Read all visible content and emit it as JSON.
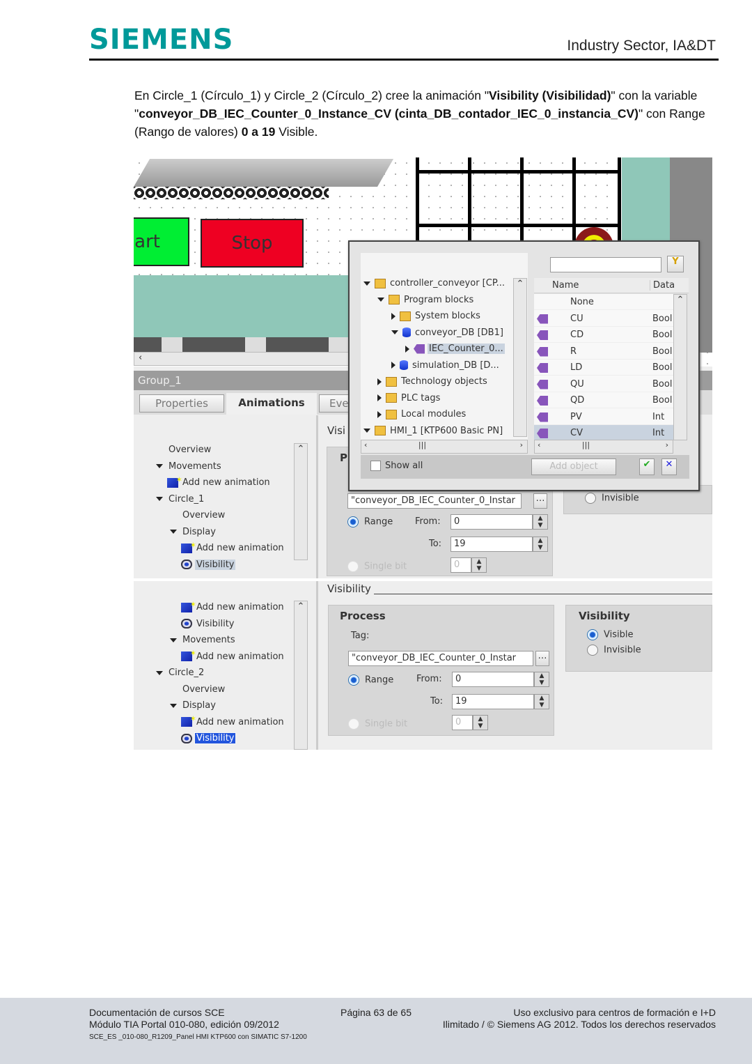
{
  "header": {
    "logo": "SIEMENS",
    "sector": "Industry Sector, IA&DT"
  },
  "intro": {
    "p1": "En Circle_1 (Círculo_1) y Circle_2 (Círculo_2) cree la animación \"",
    "b1": "Visibility (Visibilidad)",
    "p2": "\" con la variable \"",
    "b2": "conveyor_DB_IEC_Counter_0_Instance_CV (cinta_DB_contador_IEC_0_instancia_CV)",
    "p3": "\" con Range (Rango de valores) ",
    "b3": "0 a 19",
    "p4": " Visible."
  },
  "hmi": {
    "start_label": "art",
    "stop_label": "Stop",
    "colors": {
      "start": "#00ee33",
      "stop": "#ee0022",
      "teal": "#8fc7b8"
    }
  },
  "inspector": {
    "object": "Group_1",
    "tabs": [
      "Properties",
      "Animations",
      "Eve"
    ],
    "section_cut": "Visi",
    "process_cut": "P"
  },
  "tree_top": [
    {
      "label": "Overview",
      "lvl": 1,
      "icon": "",
      "exp": ""
    },
    {
      "label": "Movements",
      "lvl": 1,
      "icon": "",
      "exp": "d"
    },
    {
      "label": "Add new animation",
      "lvl": 1,
      "icon": "add",
      "exp": ""
    },
    {
      "label": "Circle_1",
      "lvl": 1,
      "icon": "",
      "exp": "d"
    },
    {
      "label": "Overview",
      "lvl": 2,
      "icon": "",
      "exp": ""
    },
    {
      "label": "Display",
      "lvl": 2,
      "icon": "",
      "exp": "d"
    },
    {
      "label": "Add new animation",
      "lvl": 2,
      "icon": "add",
      "exp": ""
    },
    {
      "label": "Visibility",
      "lvl": 2,
      "icon": "eye",
      "exp": "",
      "sel": "sel"
    }
  ],
  "tree_bottom": [
    {
      "label": "Add new animation",
      "lvl": 2,
      "icon": "add",
      "exp": ""
    },
    {
      "label": "Visibility",
      "lvl": 2,
      "icon": "eye",
      "exp": ""
    },
    {
      "label": "Movements",
      "lvl": 2,
      "icon": "",
      "exp": "d"
    },
    {
      "label": "Add new animation",
      "lvl": 2,
      "icon": "add",
      "exp": ""
    },
    {
      "label": "Circle_2",
      "lvl": 1,
      "icon": "",
      "exp": "d"
    },
    {
      "label": "Overview",
      "lvl": 2,
      "icon": "",
      "exp": ""
    },
    {
      "label": "Display",
      "lvl": 2,
      "icon": "",
      "exp": "d"
    },
    {
      "label": "Add new animation",
      "lvl": 2,
      "icon": "add",
      "exp": ""
    },
    {
      "label": "Visibility",
      "lvl": 2,
      "icon": "eye",
      "exp": "",
      "sel": "sel2"
    }
  ],
  "dialog": {
    "tree": [
      {
        "label": "controller_conveyor [CP...",
        "lvl": 0,
        "icon": "folder",
        "exp": "d"
      },
      {
        "label": "Program blocks",
        "lvl": 1,
        "icon": "folder",
        "exp": "d"
      },
      {
        "label": "System blocks",
        "lvl": 2,
        "icon": "folder",
        "exp": "r"
      },
      {
        "label": "conveyor_DB [DB1]",
        "lvl": 2,
        "icon": "db",
        "exp": "d"
      },
      {
        "label": "IEC_Counter_0...",
        "lvl": 3,
        "icon": "tag",
        "exp": "r",
        "sel": "sel"
      },
      {
        "label": "simulation_DB [D...",
        "lvl": 2,
        "icon": "db",
        "exp": "r"
      },
      {
        "label": "Technology objects",
        "lvl": 1,
        "icon": "folder",
        "exp": "r"
      },
      {
        "label": "PLC tags",
        "lvl": 1,
        "icon": "folder",
        "exp": "r"
      },
      {
        "label": "Local modules",
        "lvl": 1,
        "icon": "folder",
        "exp": "r"
      },
      {
        "label": "HMI_1 [KTP600 Basic PN]",
        "lvl": 0,
        "icon": "folder",
        "exp": "d"
      }
    ],
    "search_value": "",
    "columns": [
      "Name",
      "Data"
    ],
    "rows": [
      {
        "name": "None",
        "type": "",
        "icon": false
      },
      {
        "name": "CU",
        "type": "Bool",
        "icon": true
      },
      {
        "name": "CD",
        "type": "Bool",
        "icon": true
      },
      {
        "name": "R",
        "type": "Bool",
        "icon": true
      },
      {
        "name": "LD",
        "type": "Bool",
        "icon": true
      },
      {
        "name": "QU",
        "type": "Bool",
        "icon": true
      },
      {
        "name": "QD",
        "type": "Bool",
        "icon": true
      },
      {
        "name": "PV",
        "type": "Int",
        "icon": true
      },
      {
        "name": "CV",
        "type": "Int",
        "icon": true,
        "sel": true
      }
    ],
    "show_all": "Show all",
    "add_object": "Add object"
  },
  "form1": {
    "tag": "\"conveyor_DB_IEC_Counter_0_Instar",
    "range": "Range",
    "from_label": "From:",
    "from": "0",
    "to_label": "To:",
    "to": "19",
    "single_bit": "Single bit",
    "bit": "0",
    "invisible": "Invisible"
  },
  "form2": {
    "section": "Visibility",
    "process": "Process",
    "tag_label": "Tag:",
    "tag": "\"conveyor_DB_IEC_Counter_0_Instar",
    "range": "Range",
    "from_label": "From:",
    "from": "0",
    "to_label": "To:",
    "to": "19",
    "single_bit": "Single bit",
    "bit": "0",
    "vis_title": "Visibility",
    "visible": "Visible",
    "invisible": "Invisible"
  },
  "footer": {
    "l1": "Documentación de cursos SCE",
    "l2": "Módulo TIA Portal 010-080, edición 09/2012",
    "l3": "SCE_ES _010-080_R1209_Panel HMI KTP600 con SIMATIC S7-1200",
    "page": "Página 63 de 65",
    "r1": "Uso exclusivo para centros de formación e I+D",
    "r2": "Ilimitado / © Siemens AG 2012. Todos los derechos reservados"
  }
}
